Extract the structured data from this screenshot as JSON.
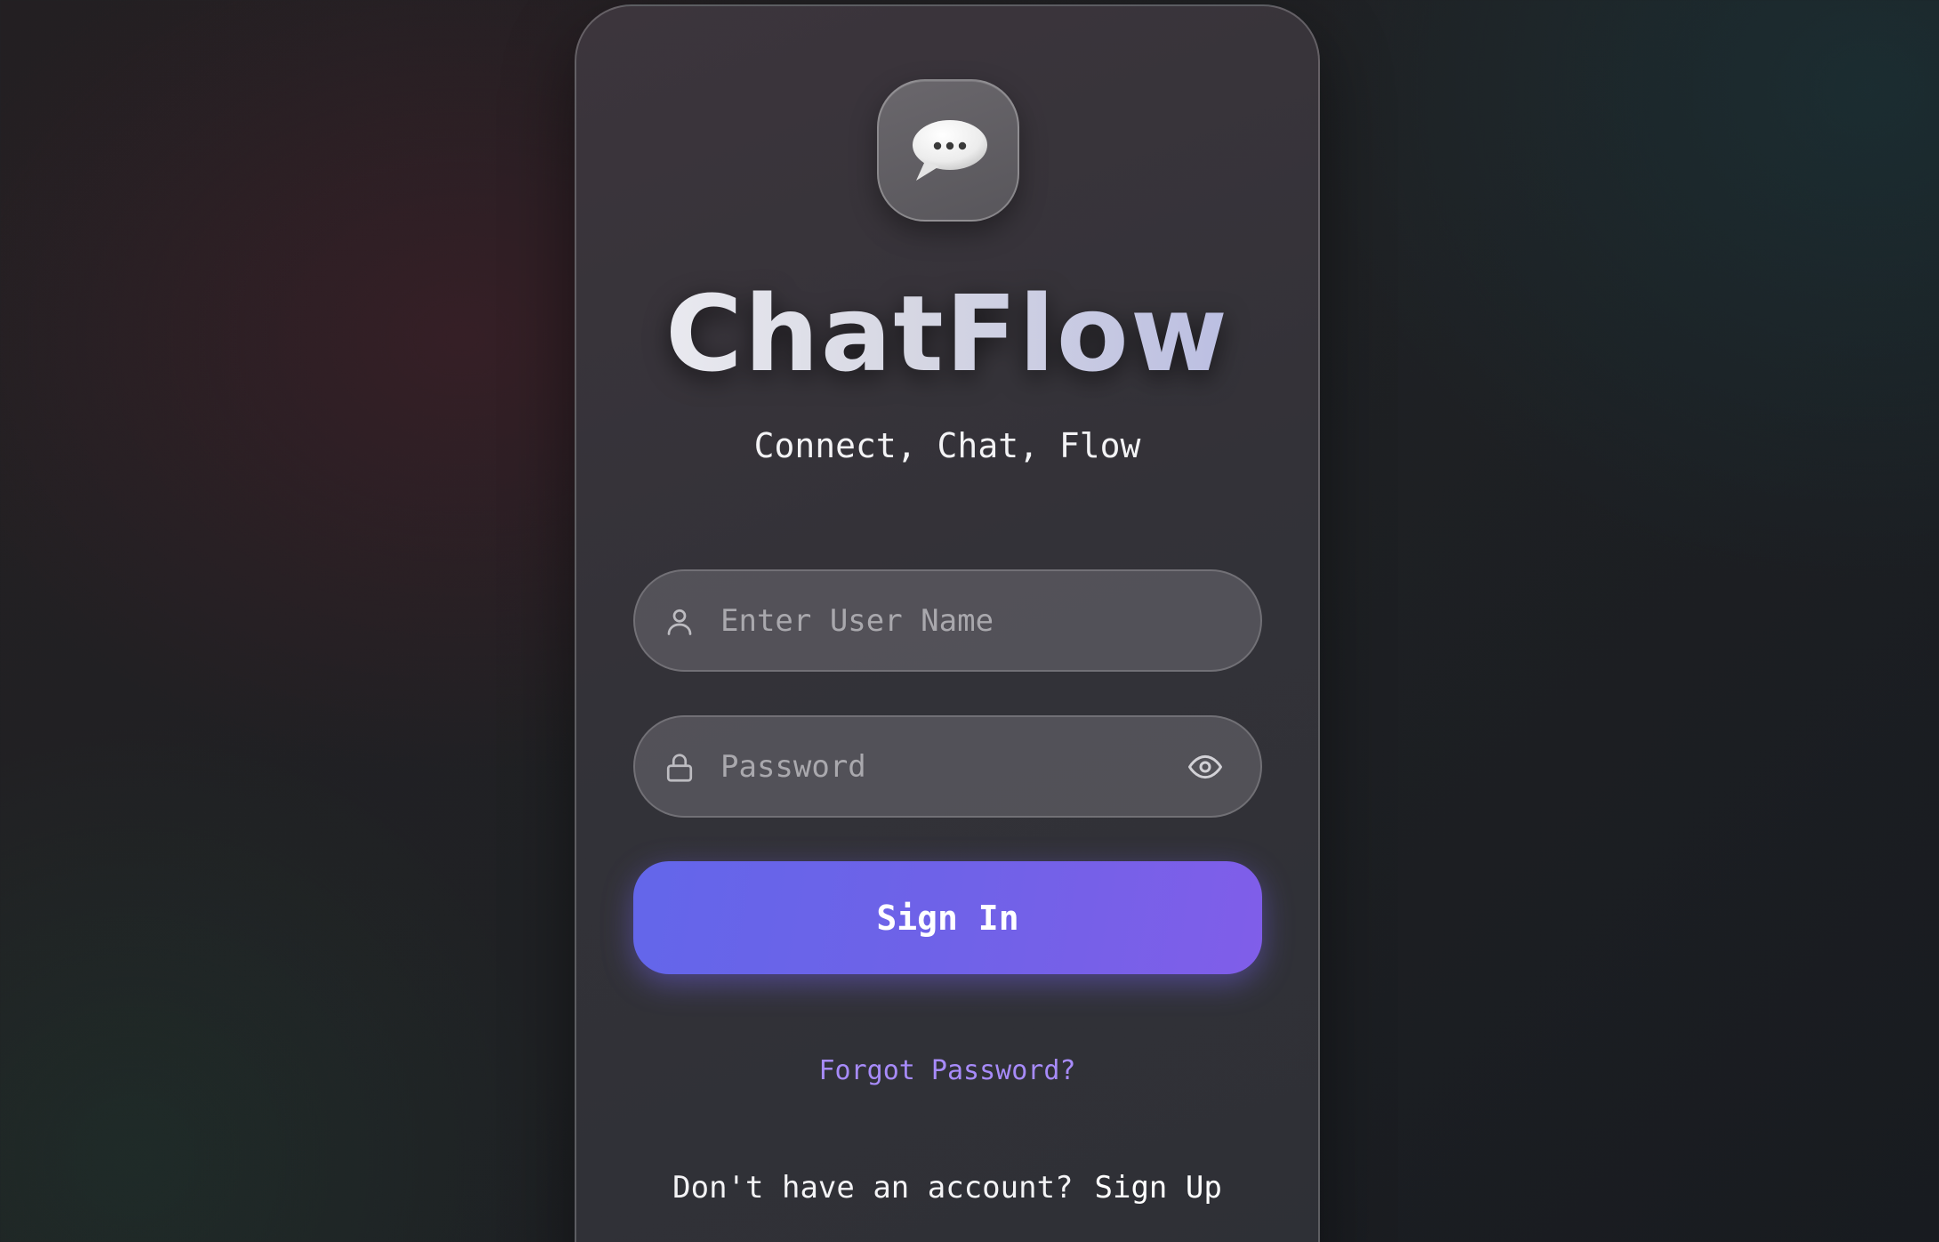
{
  "app": {
    "name": "ChatFlow",
    "tagline": "Connect, Chat, Flow",
    "logo_icon": "speech-bubble-icon"
  },
  "form": {
    "username": {
      "placeholder": "Enter User Name",
      "value": "",
      "icon": "user-icon"
    },
    "password": {
      "placeholder": "Password",
      "value": "",
      "icon": "lock-icon",
      "toggle_icon": "eye-icon"
    },
    "submit_label": "Sign In"
  },
  "links": {
    "forgot_password": "Forgot Password?",
    "signup_prompt": "Don't have an account?",
    "signup_label": "Sign Up"
  },
  "colors": {
    "accent": "#6366f1",
    "accent_end": "#8b5cf6",
    "link": "#a78bfa"
  }
}
